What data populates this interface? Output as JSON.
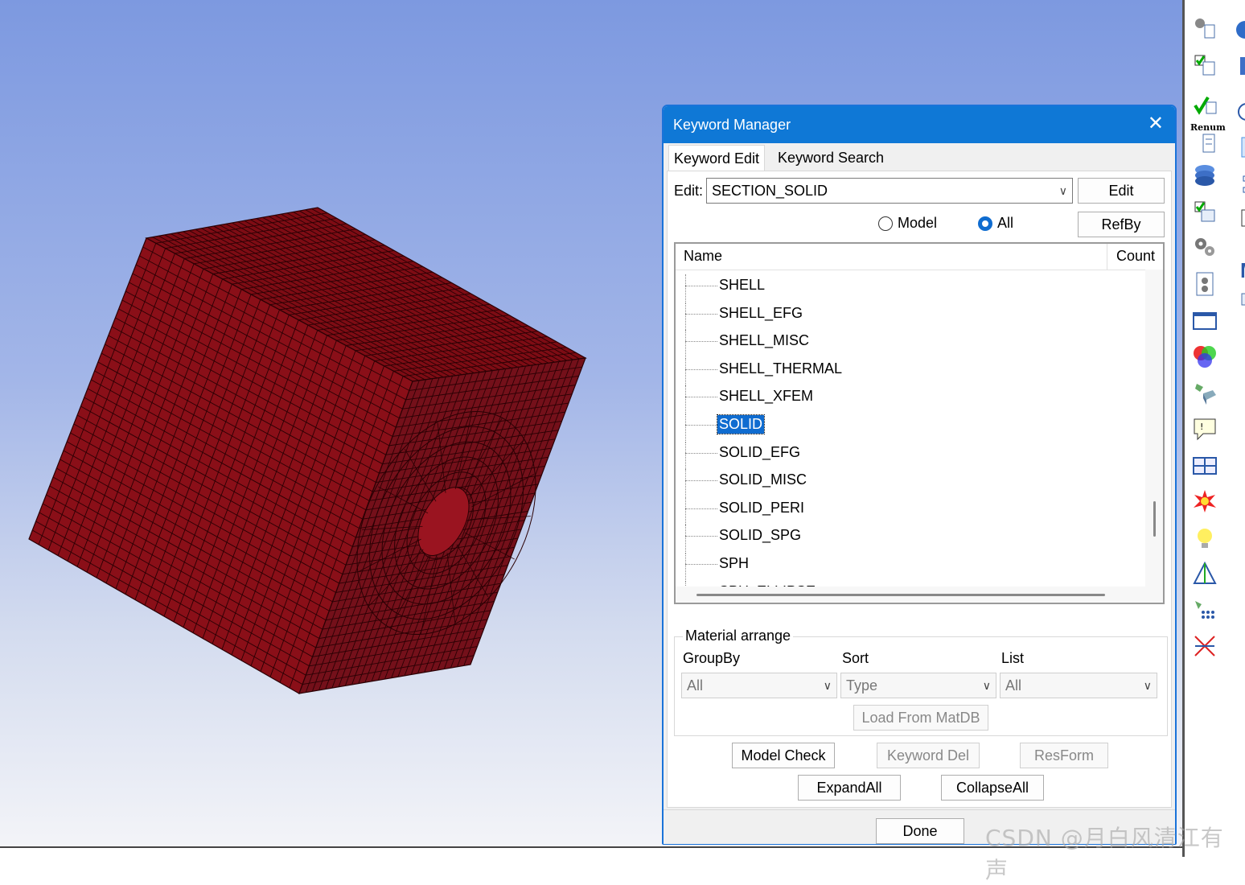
{
  "dialog": {
    "title": "Keyword Manager",
    "close_glyph": "✕",
    "tabs": [
      "Keyword Edit",
      "Keyword Search"
    ],
    "edit_label": "Edit:",
    "edit_value": "SECTION_SOLID",
    "edit_button": "Edit",
    "refby_button": "RefBy",
    "radio_model": "Model",
    "radio_all": "All",
    "radio_selected": "All",
    "list": {
      "col_name": "Name",
      "col_count": "Count",
      "items": [
        "SHELL",
        "SHELL_EFG",
        "SHELL_MISC",
        "SHELL_THERMAL",
        "SHELL_XFEM",
        "SOLID",
        "SOLID_EFG",
        "SOLID_MISC",
        "SOLID_PERI",
        "SOLID_SPG",
        "SPH",
        "SPH_ELLIPSE"
      ],
      "selected": "SOLID"
    },
    "material": {
      "title": "Material arrange",
      "groupby_label": "GroupBy",
      "groupby_value": "All",
      "sort_label": "Sort",
      "sort_value": "Type",
      "list_label": "List",
      "list_value": "All",
      "load_button": "Load From MatDB"
    },
    "buttons": {
      "model_check": "Model Check",
      "keyword_del": "Keyword Del",
      "resform": "ResForm",
      "expand_all": "ExpandAll",
      "collapse_all": "CollapseAll",
      "done": "Done"
    }
  },
  "toolbar": {
    "renum_label": "Renum"
  },
  "watermark": "CSDN @月白风清江有声",
  "colors": {
    "mesh_front": "#8a0f18",
    "mesh_top": "#7e0c14",
    "mesh_right": "#74101a",
    "titlebar": "#0f78d6",
    "selection": "#0f6cd0"
  }
}
